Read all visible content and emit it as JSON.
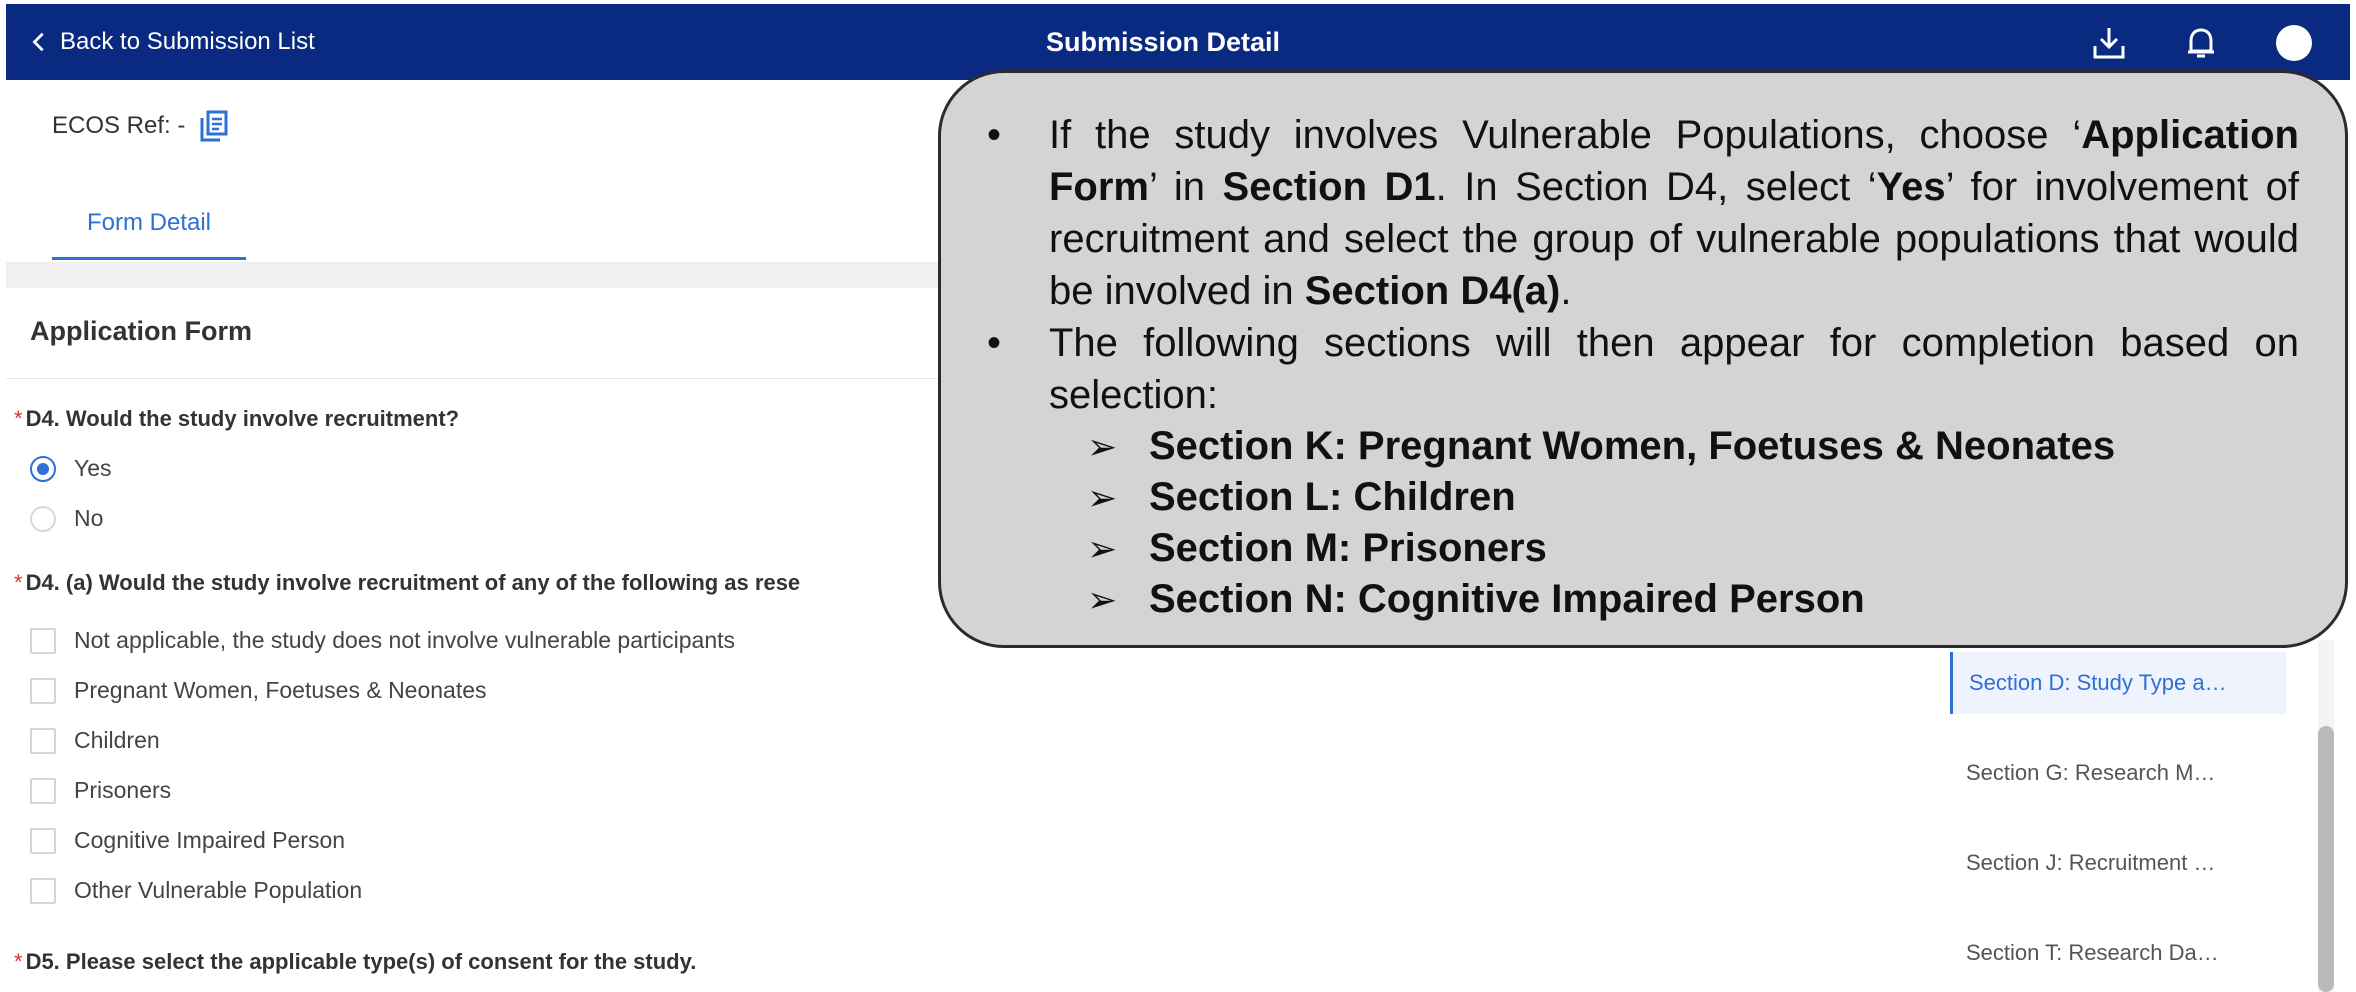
{
  "header": {
    "back_label": "Back to Submission List",
    "title": "Submission Detail",
    "icons": [
      "chevron-left-icon",
      "download-icon",
      "bell-icon",
      "avatar"
    ]
  },
  "ref": {
    "label": "ECOS Ref: -",
    "icon": "copy-icon"
  },
  "tabs": [
    {
      "label": "Form Detail",
      "active": true
    }
  ],
  "form": {
    "section_title": "Application Form",
    "q1": {
      "required": "*",
      "label": "D4. Would the study involve recruitment?",
      "options": [
        "Yes",
        "No"
      ],
      "selected": "Yes"
    },
    "q2": {
      "required": "*",
      "label": "D4. (a) Would the study involve recruitment of any of the following as rese",
      "options": [
        "Not applicable, the study does not involve vulnerable participants",
        "Pregnant Women, Foetuses & Neonates",
        "Children",
        "Prisoners",
        "Cognitive Impaired Person",
        "Other Vulnerable Population"
      ]
    },
    "q3": {
      "required": "*",
      "label": "D5. Please select the applicable type(s) of consent for the study."
    }
  },
  "sidenav": {
    "items": [
      "Section D: Study Type a…",
      "Section G: Research M…",
      "Section J: Recruitment …",
      "Section T: Research Da…"
    ],
    "active_index": 0
  },
  "callout": {
    "b1": {
      "t1": "If the study involves Vulnerable Populations, choose ‘",
      "t2": "Application Form",
      "t3": "’ in ",
      "t4": "Section D1",
      "t5": ". In Section D4, select ‘",
      "t6": "Yes",
      "t7": "’ for involvement of recruitment and select the group of vulnerable populations that would be involved in ",
      "t8": "Section D4(a)",
      "t9": "."
    },
    "b2": "The following sections will then appear for completion based on selection:",
    "subs": [
      "Section K: Pregnant Women, Foetuses & Neonates",
      "Section L: Children",
      "Section M: Prisoners",
      "Section N: Cognitive Impaired Person"
    ]
  },
  "colors": {
    "header_bg": "#0a2a82",
    "accent": "#2e6fd8",
    "required": "#e0332b",
    "callout_bg": "#d4d4d4"
  }
}
